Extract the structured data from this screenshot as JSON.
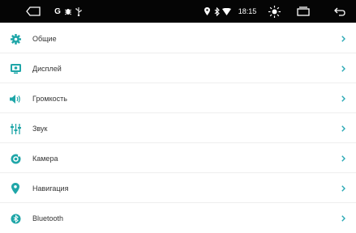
{
  "status_bar": {
    "time": "18:15",
    "notification_letter": "G",
    "icons": [
      "home-outline-icon",
      "g-notification-icon",
      "bug-icon",
      "usb-icon",
      "location-pin-icon",
      "bluetooth-icon",
      "wifi-icon",
      "brightness-icon",
      "recent-apps-icon",
      "back-icon"
    ]
  },
  "settings": {
    "items": [
      {
        "label": "Общие",
        "icon": "gear-icon"
      },
      {
        "label": "Дисплей",
        "icon": "display-icon"
      },
      {
        "label": "Громкость",
        "icon": "volume-icon"
      },
      {
        "label": "Звук",
        "icon": "equalizer-icon"
      },
      {
        "label": "Камера",
        "icon": "camera-icon"
      },
      {
        "label": "Навигация",
        "icon": "navigation-pin-icon"
      },
      {
        "label": "Bluetooth",
        "icon": "bluetooth-settings-icon"
      }
    ]
  },
  "colors": {
    "accent": "#1fa6a8",
    "status_bar_bg": "#050505",
    "text": "#333333",
    "chevron": "#2aa9b5"
  }
}
